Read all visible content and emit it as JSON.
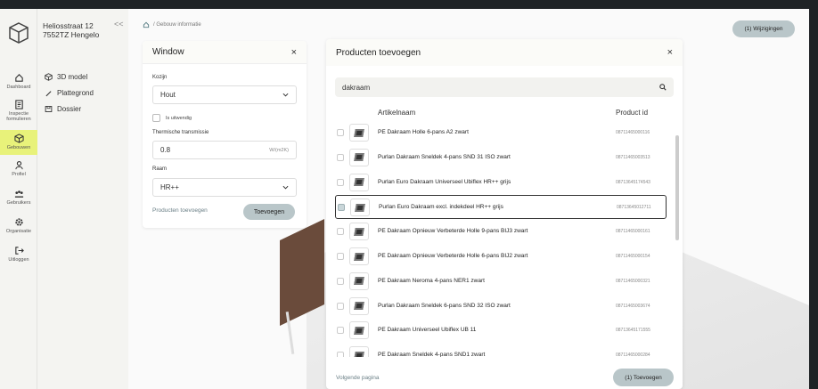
{
  "address": {
    "line1": "Heliosstraat 12",
    "line2": "7552TZ Hengelo",
    "collapse": "<<"
  },
  "rail": [
    {
      "label": "Dashboard",
      "icon": "home-icon"
    },
    {
      "label": "Inspectie formulieren",
      "icon": "form-icon"
    },
    {
      "label": "Gebouwen",
      "icon": "cube-icon",
      "active": true
    },
    {
      "label": "Profiel",
      "icon": "user-icon"
    },
    {
      "label": "Gebruikers",
      "icon": "users-icon"
    },
    {
      "label": "Organisatie",
      "icon": "gear-icon"
    },
    {
      "label": "Uitloggen",
      "icon": "logout-icon"
    }
  ],
  "menu": [
    {
      "label": "3D model",
      "icon": "cube-icon"
    },
    {
      "label": "Plattegrond",
      "icon": "pen-icon"
    },
    {
      "label": "Dossier",
      "icon": "folder-icon"
    }
  ],
  "breadcrumb": "/ Gebouw informatie",
  "changes_button": "(1) Wijzigingen",
  "window": {
    "title": "Window",
    "close": "×",
    "kozijn_label": "Kozijn",
    "kozijn_value": "Hout",
    "uitwendig_label": "Is uitwendig",
    "thermal_label": "Thermische transmissie",
    "thermal_value": "0.8",
    "thermal_unit": "W/(m2K)",
    "raam_label": "Raam",
    "raam_value": "HR++",
    "products_link": "Producten toevoegen",
    "add_button": "Toevoegen"
  },
  "products": {
    "title": "Producten toevoegen",
    "close": "×",
    "search_value": "dakraam",
    "col_name": "Artikelnaam",
    "col_id": "Product id",
    "rows": [
      {
        "name": "PE Dakraam Holle 6-pans A2 zwart",
        "id": "08711465000116",
        "selected": false
      },
      {
        "name": "Purlan Dakraam Sneldek 4-pans SND 31 ISO zwart",
        "id": "08711465003513",
        "selected": false
      },
      {
        "name": "Purlan Euro Dakraam Universeel Ubiflex HR++ grijs",
        "id": "08713645174543",
        "selected": false
      },
      {
        "name": "Purlan Euro Dakraam excl. indekdeel HR++ grijs",
        "id": "08713645012711",
        "selected": true
      },
      {
        "name": "PE Dakraam Opnieuw Verbeterde Holle 9-pans BIJ3 zwart",
        "id": "08711465000161",
        "selected": false
      },
      {
        "name": "PE Dakraam Opnieuw Verbeterde Holle 6-pans BIJ2 zwart",
        "id": "08711465000154",
        "selected": false
      },
      {
        "name": "PE Dakraam Neroma 4-pans NER1 zwart",
        "id": "08711465000321",
        "selected": false
      },
      {
        "name": "Purlan Dakraam Sneldek 6-pans SND 32 ISO zwart",
        "id": "08711465003674",
        "selected": false
      },
      {
        "name": "PE Dakraam Universeel Ubiflex UB 11",
        "id": "08713645171555",
        "selected": false
      },
      {
        "name": "PE Dakraam Sneldek 4-pans SND1 zwart",
        "id": "08711465000284",
        "selected": false
      }
    ],
    "next_page": "Volgende pagina",
    "add_button": "(1) Toevoegen"
  }
}
